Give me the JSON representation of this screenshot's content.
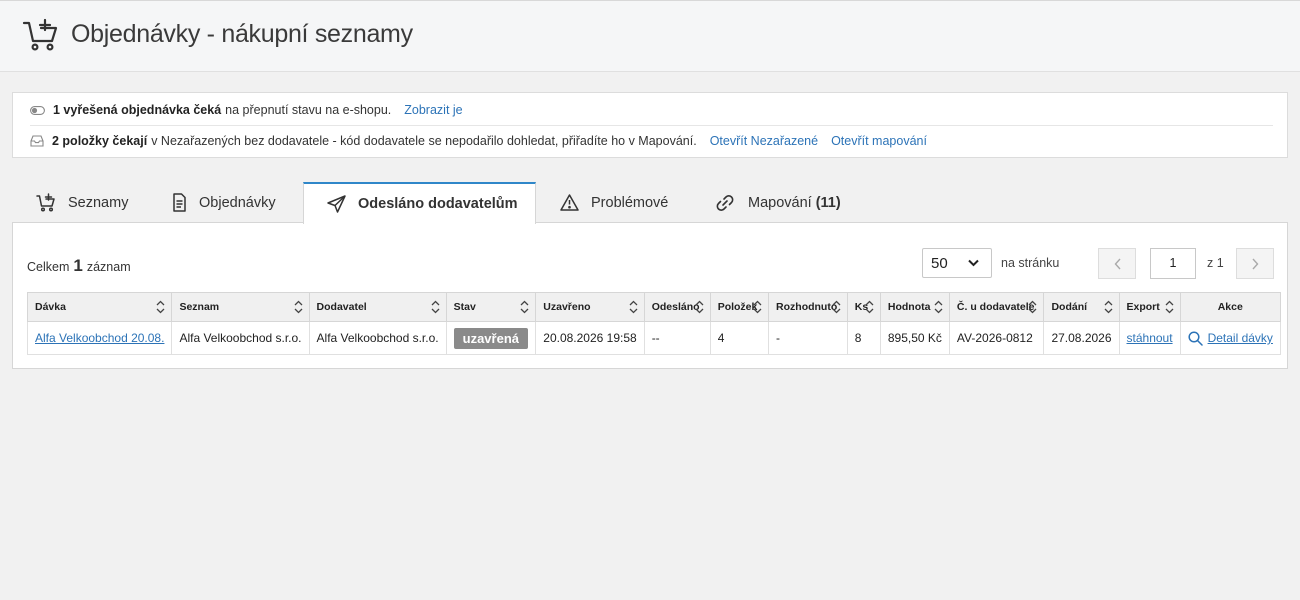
{
  "header": {
    "title": "Objednávky - nákupní seznamy"
  },
  "notices": [
    {
      "icon": "toggle-icon",
      "bold": "1 vyřešená objednávka čeká",
      "text": "na přepnutí stavu na e-shopu.",
      "links": [
        "Zobrazit je"
      ]
    },
    {
      "icon": "inbox-icon",
      "bold": "2 položky čekají",
      "text": "v Nezařazených bez dodavatele - kód dodavatele se nepodařilo dohledat, přiřadíte ho v Mapování.",
      "links": [
        "Otevřít Nezařazené",
        "Otevřít mapování"
      ]
    }
  ],
  "tabs": [
    {
      "label": "Seznamy",
      "icon": "cart-icon"
    },
    {
      "label": "Objednávky",
      "icon": "document-icon"
    },
    {
      "label": "Odesláno dodavatelům",
      "icon": "paper-plane-icon",
      "active": true
    },
    {
      "label": "Problémové",
      "icon": "warning-icon"
    },
    {
      "label": "Mapování",
      "count": "(11)",
      "icon": "link-icon"
    }
  ],
  "summary": {
    "prefix": "Celkem",
    "count": "1",
    "suffix": "záznam"
  },
  "pagination": {
    "per_page": "50",
    "per_page_label": "na stránku",
    "page": "1",
    "of_label": "z 1"
  },
  "table": {
    "columns": [
      "Dávka",
      "Seznam",
      "Dodavatel",
      "Stav",
      "Uzavřeno",
      "Odesláno",
      "Položek",
      "Rozhodnuto",
      "Ks",
      "Hodnota",
      "Č. u dodavatele",
      "Dodání",
      "Export",
      "Akce"
    ],
    "rows": [
      {
        "davka": "Alfa Velkoobchod 20.08.",
        "seznam": "Alfa Velkoobchod s.r.o.",
        "dodavatel": "Alfa Velkoobchod s.r.o.",
        "stav": "uzavřená",
        "uzavreno": "20.08.2026 19:58",
        "odeslano": "--",
        "polozek": "4",
        "rozhodnuto": "-",
        "ks": "8",
        "hodnota": "895,50 Kč",
        "cislo": "AV-2026-0812",
        "dodani": "27.08.2026",
        "export": "stáhnout",
        "akce": "Detail dávky"
      }
    ]
  }
}
